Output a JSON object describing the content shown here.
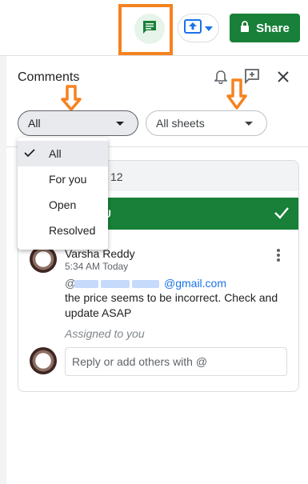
{
  "toolbar": {
    "share_label": "Share",
    "comment_icon": "comment-icon",
    "upload_icon": "upload-icon",
    "lock_icon": "lock-icon"
  },
  "panel": {
    "title": "Comments",
    "filter_all_label": "All",
    "filter_sheets_label": "All sheets",
    "filter_menu": [
      {
        "label": "All",
        "selected": true
      },
      {
        "label": "For you",
        "selected": false
      },
      {
        "label": "Open",
        "selected": false
      },
      {
        "label": "Resolved",
        "selected": false
      }
    ]
  },
  "comment": {
    "header_fragment": "12",
    "assigned_banner": "OU",
    "author": "Varsha Reddy",
    "time": "5:34 AM Today",
    "mention_at": "@",
    "mention_domain": "@gmail.com",
    "body": "the price seems to be incorrect. Check and update ASAP",
    "assigned_note": "Assigned to you",
    "reply_placeholder": "Reply or add others with @"
  },
  "colors": {
    "accent_green": "#188038",
    "highlight_orange": "#f58220",
    "link_blue": "#1a73e8"
  }
}
